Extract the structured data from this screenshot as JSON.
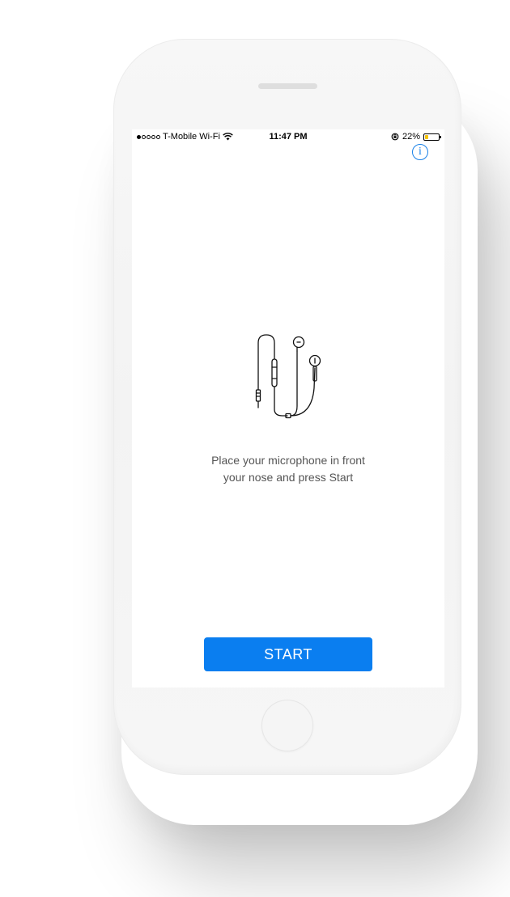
{
  "status_bar": {
    "carrier": "T-Mobile Wi-Fi",
    "time": "11:47 PM",
    "battery_percent": "22%",
    "battery_level": 0.22,
    "signal_bars_filled": 1,
    "signal_bars_total": 5
  },
  "header": {
    "info_label": "i"
  },
  "main": {
    "illustration": "earphones-icon",
    "instruction_line1": "Place your microphone in front",
    "instruction_line2": "your nose and press Start"
  },
  "footer": {
    "start_label": "START"
  },
  "colors": {
    "accent": "#0a7ef0",
    "info": "#1a82e8",
    "battery": "#f5c400",
    "text_secondary": "#555555"
  }
}
